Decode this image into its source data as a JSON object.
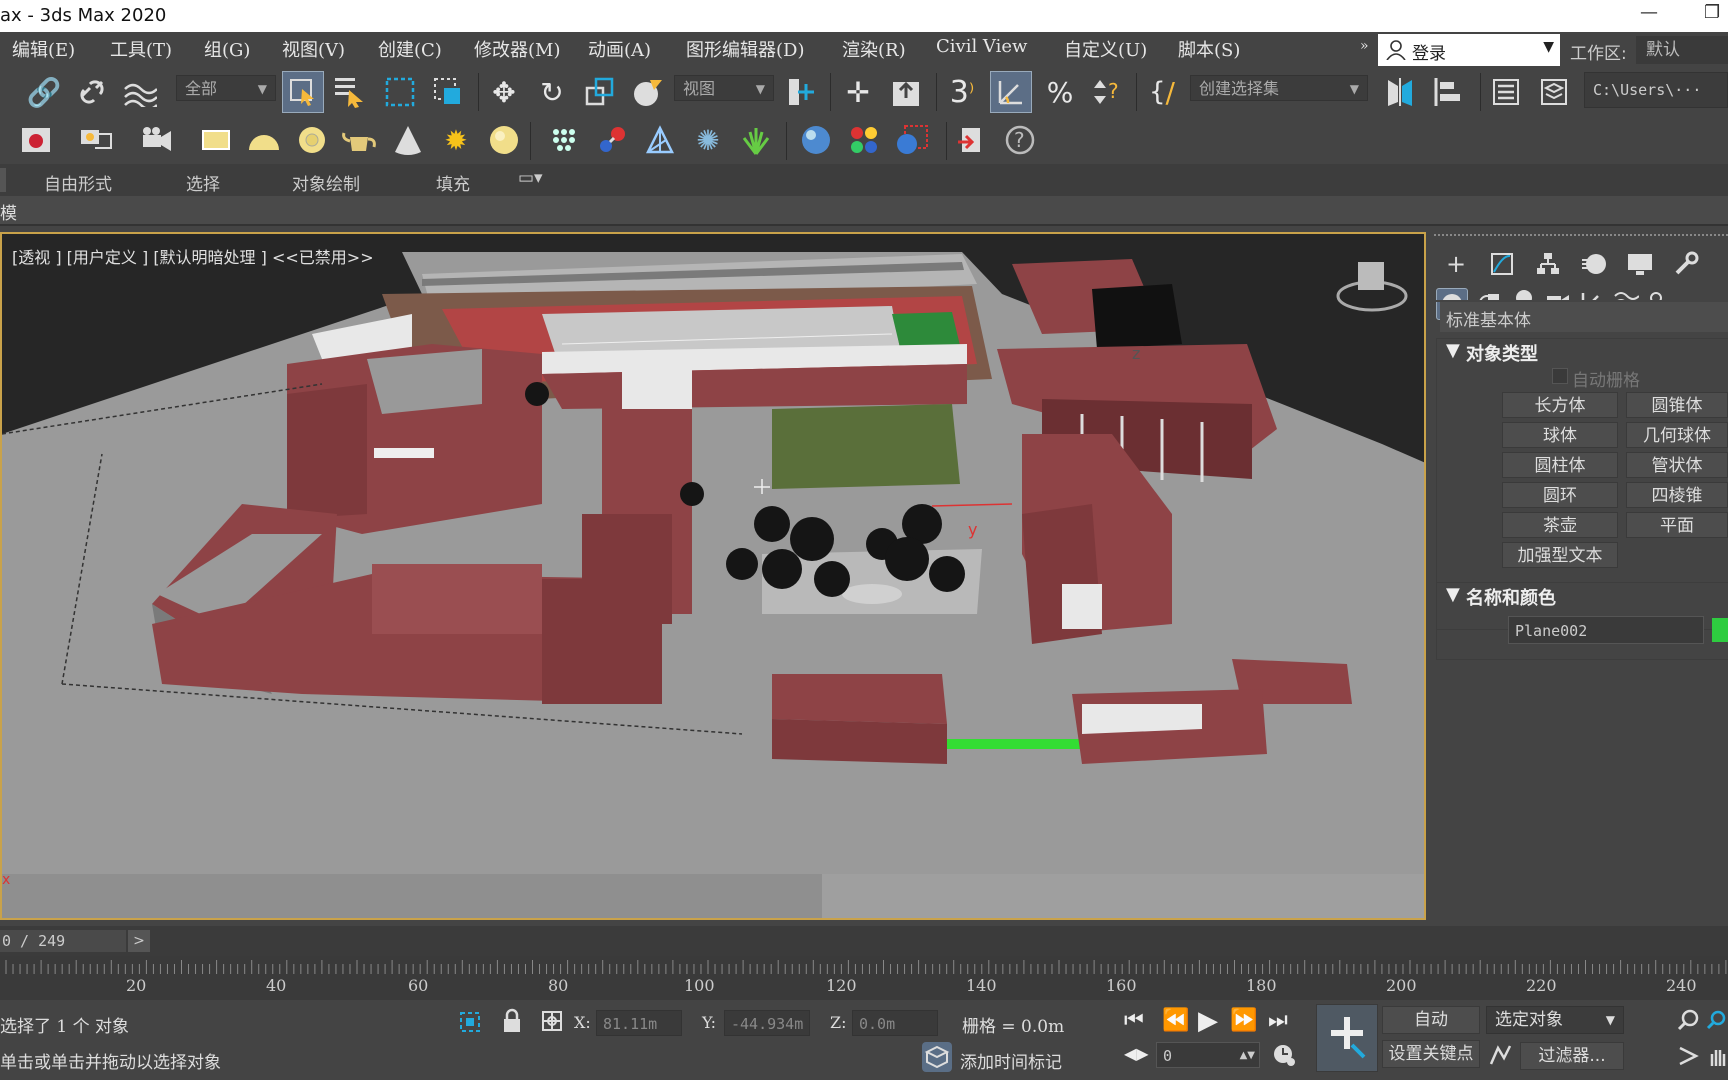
{
  "window": {
    "title": "ax - 3ds Max 2020",
    "min_glyph": "—",
    "restore_glyph": "❐"
  },
  "menu": {
    "items": [
      "编辑(E)",
      "工具(T)",
      "组(G)",
      "视图(V)",
      "创建(C)",
      "修改器(M)",
      "动画(A)",
      "图形编辑器(D)",
      "渲染(R)",
      "Civil View",
      "自定义(U)",
      "脚本(S)"
    ],
    "overflow": "»",
    "login": "登录",
    "workspace_label": "工作区:",
    "workspace_value": "默认"
  },
  "toolbar": {
    "selection_filter": "全部",
    "ref_coord": "视图",
    "snap_label": "3",
    "named_selection": "创建选择集",
    "path": "C:\\Users\\··· Max"
  },
  "ribbon": {
    "tabs": [
      "自由形式",
      "选择",
      "对象绘制",
      "填充"
    ],
    "modeling_label": "模"
  },
  "viewport": {
    "label": "[透视 ] [用户定义 ] [默认明暗处理 ] <<已禁用>>",
    "axis_y": "y",
    "axis_z": "z",
    "corner_axes": "x"
  },
  "command_panel": {
    "category": "标准基本体",
    "rollout_object_type": "对象类型",
    "autogrid": "自动栅格",
    "buttons": [
      "长方体",
      "圆锥体",
      "球体",
      "几何球体",
      "圆柱体",
      "管状体",
      "圆环",
      "四棱锥",
      "茶壶",
      "平面",
      "加强型文本"
    ],
    "rollout_name_color": "名称和颜色",
    "object_name": "Plane002",
    "object_color": "#2ecc40"
  },
  "timeline": {
    "frame_display": "0 / 249",
    "ticks": [
      "20",
      "40",
      "60",
      "80",
      "100",
      "120",
      "140",
      "160",
      "180",
      "200",
      "220",
      "240"
    ]
  },
  "status": {
    "selected": "选择了 1 个 对象",
    "prompt": "单击或单击并拖动以选择对象",
    "x_label": "X:",
    "x_value": "81.11m",
    "y_label": "Y:",
    "y_value": "-44.934m",
    "z_label": "Z:",
    "z_value": "0.0m",
    "grid": "栅格 = 0.0m",
    "add_time_tag": "添加时间标记",
    "auto_key": "自动",
    "set_key": "设置关键点",
    "selected_objects": "选定对象",
    "filters": "过滤器...",
    "frame_spinner": "0"
  },
  "colors": {
    "accent_yellow": "#c9a24a",
    "building_red": "#8e4346",
    "ground_gray": "#9a9a9a"
  }
}
